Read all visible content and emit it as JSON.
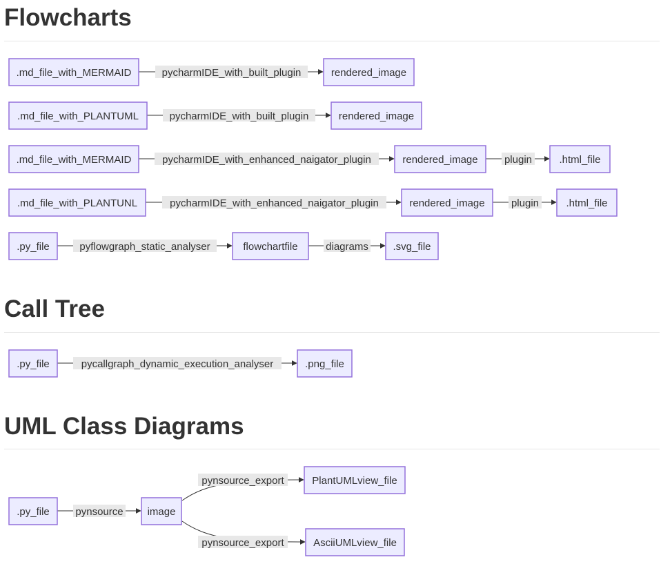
{
  "sections": {
    "flowcharts": {
      "title": "Flowcharts"
    },
    "call_tree": {
      "title": "Call Tree"
    },
    "uml": {
      "title": "UML Class Diagrams"
    }
  },
  "colors": {
    "node_fill": "#ECECFF",
    "node_stroke": "#9370DB",
    "label_bg": "#e8e8e8",
    "edge": "#333333"
  },
  "flows": {
    "row1": {
      "source": ".md_file_with_MERMAID",
      "edge1": "pycharmIDE_with_built_plugin",
      "target1": "rendered_image"
    },
    "row2": {
      "source": ".md_file_with_PLANTUML",
      "edge1": "pycharmIDE_with_built_plugin",
      "target1": "rendered_image"
    },
    "row3": {
      "source": ".md_file_with_MERMAID",
      "edge1": "pycharmIDE_with_enhanced_naigator_plugin",
      "target1": "rendered_image",
      "edge2": "plugin",
      "target2": ".html_file"
    },
    "row4": {
      "source": ".md_file_with_PLANTUNL",
      "edge1": "pycharmIDE_with_enhanced_naigator_plugin",
      "target1": "rendered_image",
      "edge2": "plugin",
      "target2": ".html_file"
    },
    "row5": {
      "source": ".py_file",
      "edge1": "pyflowgraph_static_analyser",
      "target1": "flowchartfile",
      "edge2": "diagrams",
      "target2": ".svg_file"
    }
  },
  "calltree": {
    "source": ".py_file",
    "edge1": "pycallgraph_dynamic_execution_analyser",
    "target1": ".png_file"
  },
  "uml": {
    "source": ".py_file",
    "edge1": "pynsource",
    "middle": "image",
    "edge_top": "pynsource_export",
    "target_top": "PlantUMLview_file",
    "edge_bottom": "pynsource_export",
    "target_bottom": "AsciiUMLview_file"
  }
}
